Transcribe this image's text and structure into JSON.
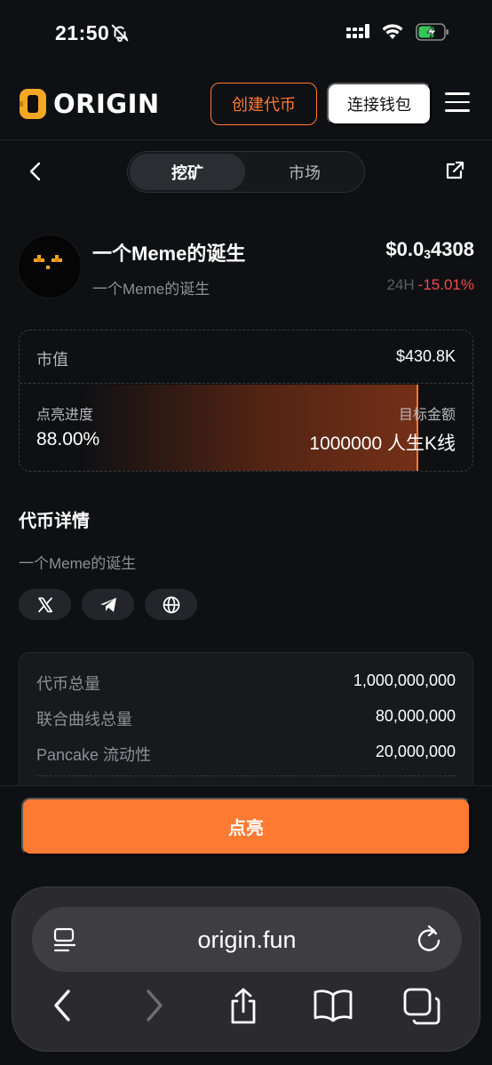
{
  "status_bar": {
    "time": "21:50",
    "icons": [
      "bell-slash-icon",
      "signal-icon",
      "wifi-icon",
      "battery-charging-icon"
    ]
  },
  "header": {
    "logo_text": "ORIGIN",
    "create_button": "创建代币",
    "connect_button": "连接钱包",
    "icons": [
      "logo-icon",
      "hamburger-menu-icon"
    ]
  },
  "subnav": {
    "tabs": [
      {
        "label": "挖矿",
        "active": true
      },
      {
        "label": "市场",
        "active": false
      }
    ],
    "icons": [
      "chevron-left-icon",
      "external-link-icon"
    ]
  },
  "token": {
    "name": "一个Meme的诞生",
    "subtitle": "一个Meme的诞生",
    "price_prefix": "$0.0",
    "price_zeros": "3",
    "price_digits": "4308",
    "change_label": "24H",
    "change_value": "-15.01%"
  },
  "stats": {
    "market_cap_label": "市值",
    "market_cap_value": "$430.8K",
    "progress_label": "点亮进度",
    "progress_value": "88.00%",
    "progress_fraction": 0.88,
    "target_label": "目标金额",
    "target_value": "1000000 人生K线"
  },
  "details": {
    "title": "代币详情",
    "description": "一个Meme的诞生",
    "social_icons": [
      "x-icon",
      "telegram-icon",
      "globe-icon"
    ],
    "supply": [
      {
        "label": "代币总量",
        "value": "1,000,000,000"
      },
      {
        "label": "联合曲线总量",
        "value": "80,000,000"
      },
      {
        "label": "Pancake 流动性",
        "value": "20,000,000"
      }
    ]
  },
  "action": {
    "button": "点亮"
  },
  "browser": {
    "url": "origin.fun",
    "icons": [
      "reader-icon",
      "reload-icon",
      "back-arrow-icon",
      "forward-arrow-icon",
      "share-icon",
      "bookmarks-icon",
      "tabs-icon"
    ]
  },
  "colors": {
    "accent": "#ff7a33",
    "negative": "#f34b4b",
    "background": "#0f1013"
  }
}
